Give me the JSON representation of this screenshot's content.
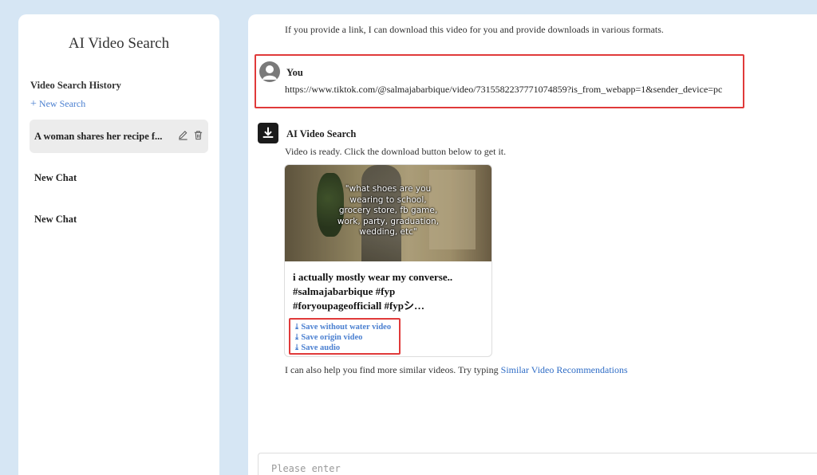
{
  "sidebar": {
    "app_title": "AI Video Search",
    "history_label": "Video Search History",
    "new_search_label": "New Search",
    "items": [
      {
        "label": "A woman shares her recipe f..."
      },
      {
        "label": "New Chat"
      },
      {
        "label": "New Chat"
      }
    ]
  },
  "chat": {
    "top_line": "If you provide a link, I can download this video for you and provide downloads in various formats.",
    "user": {
      "name": "You",
      "message": "https://www.tiktok.com/@salmajabarbique/video/7315582237771074859?is_from_webapp=1&sender_device=pc"
    },
    "bot": {
      "name": "AI Video Search",
      "ready_text": "Video is ready. Click the download button below to get it.",
      "video": {
        "caption": "\"what shoes are you\nwearing to school,\ngrocery store, fb game,\nwork, party, graduation,\nwedding, etc\"",
        "title": "i actually mostly wear my converse.. #salmajabarbique #fyp #foryoupageofficiall #fypシ…"
      },
      "downloads": [
        "Save without water video",
        "Save origin video",
        "Save audio"
      ],
      "also_text": "I can also help you find more similar videos. Try typing ",
      "also_link": "Similar Video Recommendations"
    }
  },
  "input": {
    "placeholder": "Please enter"
  }
}
